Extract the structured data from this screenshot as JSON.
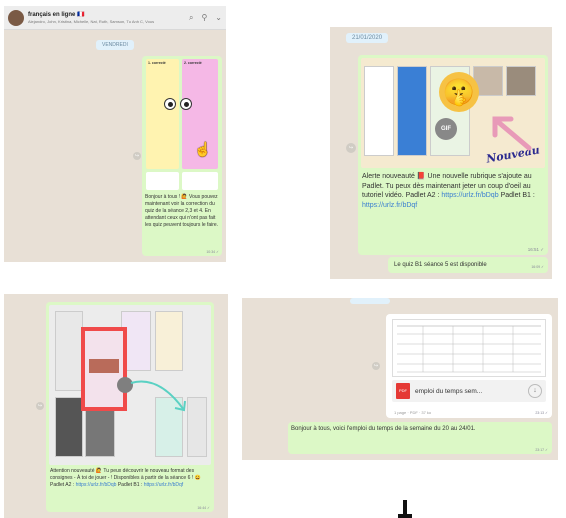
{
  "panel1": {
    "chat_title": "français en ligne 🇫🇷",
    "chat_members": "Alejandro, John, Kristina, Michelle, Nat, Ruth, Samson, Tu Anh C, Vous",
    "date_chip": "VENDREDI",
    "card_left_title": "1. correcté",
    "card_right_title": "2. correcté",
    "message": "Bonjour à tous ! 🙋 Vous pouvez maintenant voir la correction du quiz de la séance 2,3 et 4. En attendant ceux qui n'ont pas fait les quiz peuvent toujours le faire.",
    "time": "10:34 ✓"
  },
  "panel2": {
    "date_chip": "21/01/2020",
    "gif_label": "GIF",
    "nouveau_label": "Nouveau",
    "message_part1": "Alerte nouveauté 📕 Une nouvelle rubrique s'ajoute au Padlet.",
    "message_part2": "Tu peux dès maintenant jeter un coup d'oeil au tutoriel vidéo.",
    "padlet_a2": "Padlet A2 :",
    "link_a2": "https://urlz.fr/bDqb",
    "padlet_b1": "Padlet B1 :",
    "link_b1": "https://urlz.fr/bDqf",
    "time1": "16:51 ✓",
    "message2": "Le quiz B1 séance 5 est disponible",
    "time2": "16:09 ✓"
  },
  "panel3": {
    "message": "Attention nouveauté 🙋 Tu peux découvrir le nouveau format des consignes - À toi de jouer - ! Disponibles à partir de la séance 6 ! 😀",
    "padlet_a2": "Padlet A2 :",
    "link_a2": "https://urlz.fr/bDqb",
    "padlet_b1": "Padlet B1 :",
    "link_b1": "https://urlz.fr/bDqf",
    "time": "16:44 ✓"
  },
  "panel4": {
    "file_name": "emploi du temps sem...",
    "file_icon": "PDF",
    "file_meta": "1 page · PDF · 37 ko",
    "time1": "23:13 ✓",
    "message": "Bonjour à tous, voici l'emploi du temps de la semaine du 20 au 24/01.",
    "time2": "23:17 ✓"
  }
}
